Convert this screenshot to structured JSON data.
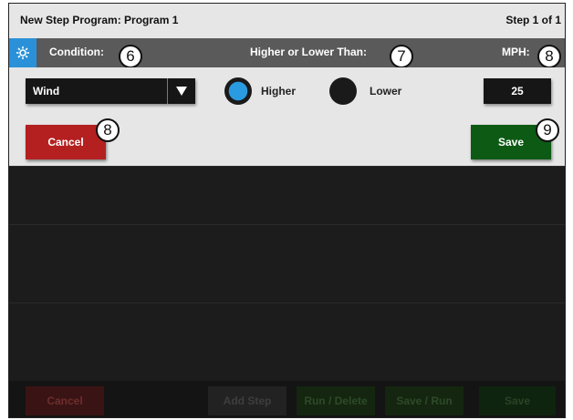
{
  "header": {
    "title": "New Step Program:  Program 1",
    "step": "Step 1 of 1"
  },
  "condition_bar": {
    "icon": "gear-icon",
    "condition_label": "Condition:",
    "compare_label": "Higher or Lower Than:",
    "unit_label": "MPH:"
  },
  "callouts": {
    "condition": "6",
    "compare": "7",
    "unit": "8",
    "cancel": "8",
    "save": "9"
  },
  "form": {
    "condition_value": "Wind",
    "higher_label": "Higher",
    "lower_label": "Lower",
    "selected_option": "Higher",
    "mph_value": "25",
    "cancel_label": "Cancel",
    "save_label": "Save"
  },
  "footer": {
    "cancel": "Cancel",
    "add_step": "Add Step",
    "run_delete": "Run / Delete",
    "save_run": "Save / Run",
    "save": "Save"
  },
  "colors": {
    "accent_blue": "#2a91d8",
    "cancel_red": "#b42020",
    "save_green": "#0d5a15",
    "condition_bar": "#5a5a5a"
  }
}
